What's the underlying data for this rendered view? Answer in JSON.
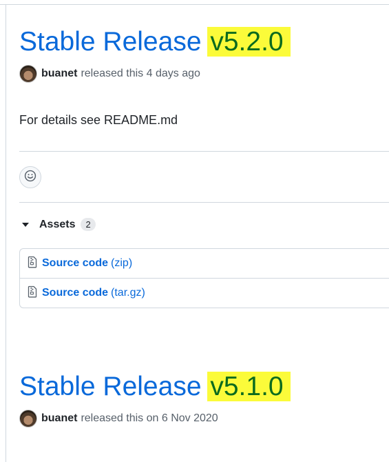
{
  "releases": [
    {
      "title": "Stable Release",
      "version": "v5.2.0",
      "author": "buanet",
      "released_text": "released this 4 days ago",
      "body": "For details see README.md",
      "assets_label": "Assets",
      "assets_count": "2",
      "assets": [
        {
          "name": "Source code",
          "ext": "(zip)"
        },
        {
          "name": "Source code",
          "ext": "(tar.gz)"
        }
      ]
    },
    {
      "title": "Stable Release",
      "version": "v5.1.0",
      "author": "buanet",
      "released_text": "released this on 6 Nov 2020"
    }
  ],
  "icons": {
    "smiley": "smiley-icon",
    "caret": "triangle-down-icon",
    "zip": "file-zip-icon"
  },
  "colors": {
    "link": "#0969da",
    "highlight": "#fbfb3a",
    "version_text": "#0b6b1e",
    "border": "#d0d7de"
  }
}
